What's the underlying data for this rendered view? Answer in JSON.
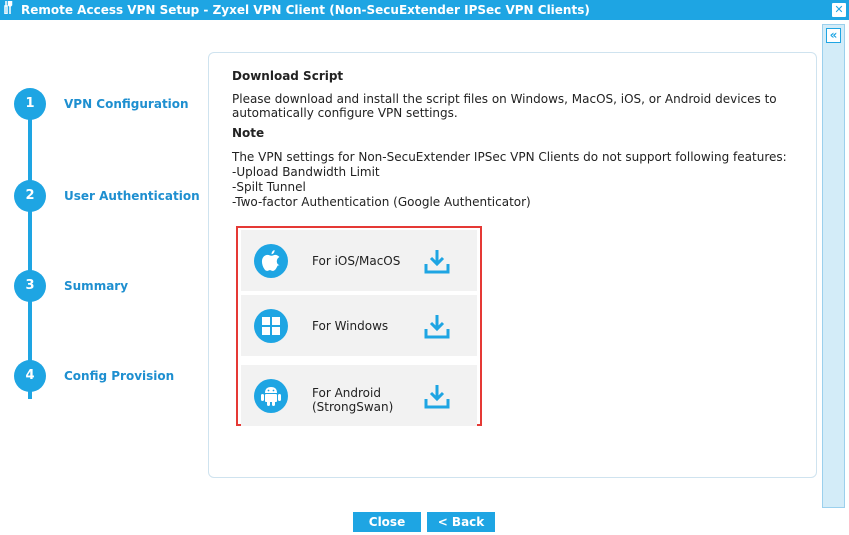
{
  "window": {
    "title": "Remote Access VPN Setup - Zyxel VPN Client (Non-SecuExtender IPSec VPN Clients)",
    "close_glyph": "✕"
  },
  "steps": [
    {
      "number": "1",
      "label": "VPN Configuration"
    },
    {
      "number": "2",
      "label": "User Authentication"
    },
    {
      "number": "3",
      "label": "Summary"
    },
    {
      "number": "4",
      "label": "Config Provision"
    }
  ],
  "content": {
    "download_heading": "Download Script",
    "download_text": "Please download and install the script files on Windows, MacOS, iOS, or Android devices to automatically configure VPN settings.",
    "note_heading": "Note",
    "note_text": "The VPN settings for Non-SecuExtender IPSec VPN Clients do not support following features:",
    "features": [
      "-Upload Bandwidth Limit",
      "-Spilt Tunnel",
      "-Two-factor Authentication (Google Authenticator)"
    ]
  },
  "downloads": [
    {
      "icon": "apple-icon",
      "label_line1": "For iOS/MacOS",
      "label_line2": ""
    },
    {
      "icon": "windows-icon",
      "label_line1": "For Windows",
      "label_line2": ""
    },
    {
      "icon": "android-icon",
      "label_line1": "For Android",
      "label_line2": "(StrongSwan)"
    }
  ],
  "sidebar": {
    "collapse_glyph": "«"
  },
  "footer": {
    "close_label": "Close",
    "back_label": "< Back"
  },
  "colors": {
    "accent": "#1ea5e3",
    "highlight_border": "#e53935"
  }
}
